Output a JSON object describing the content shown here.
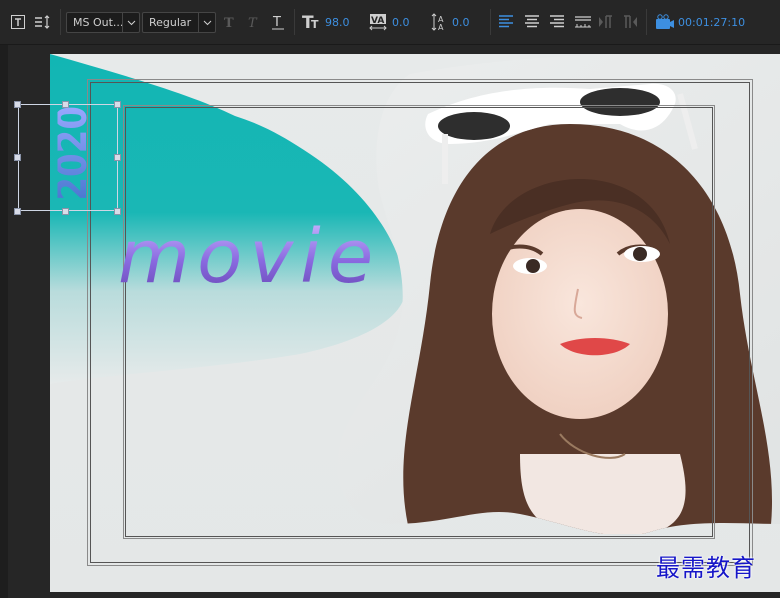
{
  "toolbar": {
    "font_family": "MS Out...",
    "font_style": "Regular",
    "font_size": "98.0",
    "tracking": "0.0",
    "leading": "0.0",
    "timecode": "00:01:27:10"
  },
  "canvas": {
    "title_text": "movie",
    "vertical_text": "2020",
    "watermark": "最需教育"
  },
  "colors": {
    "accent": "#3d8fe0",
    "teal": "#12b6b4",
    "movie_text": "#8a6ae0"
  }
}
